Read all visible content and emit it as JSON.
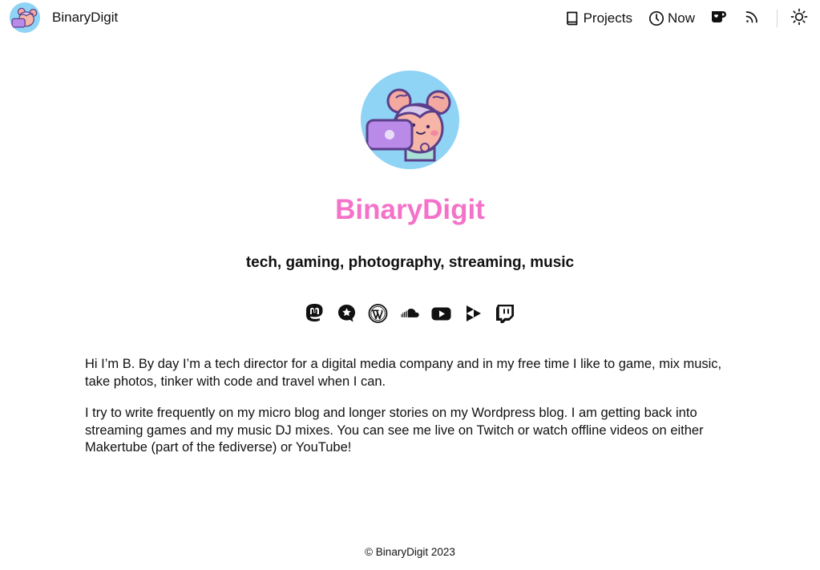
{
  "header": {
    "site_name": "BinaryDigit",
    "nav": [
      {
        "label": "Projects",
        "icon": "book-icon"
      },
      {
        "label": "Now",
        "icon": "clock-icon"
      }
    ],
    "icons": [
      "kofi-cup-icon",
      "rss-icon",
      "sun-icon"
    ]
  },
  "hero": {
    "title": "BinaryDigit",
    "tagline": "tech, gaming, photography, streaming, music"
  },
  "socials": [
    "mastodon-icon",
    "micro-blog-icon",
    "wordpress-icon",
    "soundcloud-icon",
    "youtube-icon",
    "peertube-icon",
    "twitch-icon"
  ],
  "bio": {
    "p1": "Hi I’m B. By day I’m a tech director for a digital media company and in my free time I like to game, mix music, take photos, tinker with code and travel when I can.",
    "p2": "I try to write frequently on my micro blog and longer stories on my Wordpress blog. I am getting back into streaming games and my music DJ mixes. You can see me live on Twitch or watch offline videos on either Makertube (part of the fediverse) or YouTube!"
  },
  "footer": {
    "copyright": "© BinaryDigit 2023"
  },
  "colors": {
    "accent": "#f472c9",
    "avatar_bg": "#8fd3f5",
    "text": "#111111"
  }
}
